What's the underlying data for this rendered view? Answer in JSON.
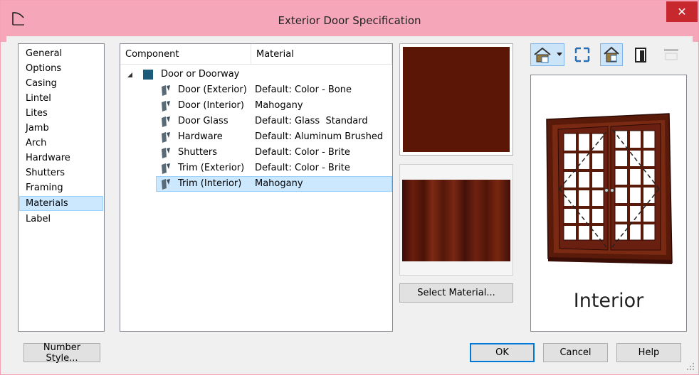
{
  "window": {
    "title": "Exterior Door Specification",
    "close_glyph": "✕",
    "accent": "#f6a6b9"
  },
  "nav": {
    "items": [
      {
        "label": "General",
        "selected": false
      },
      {
        "label": "Options",
        "selected": false
      },
      {
        "label": "Casing",
        "selected": false
      },
      {
        "label": "Lintel",
        "selected": false
      },
      {
        "label": "Lites",
        "selected": false
      },
      {
        "label": "Jamb",
        "selected": false
      },
      {
        "label": "Arch",
        "selected": false
      },
      {
        "label": "Hardware",
        "selected": false
      },
      {
        "label": "Shutters",
        "selected": false
      },
      {
        "label": "Framing",
        "selected": false
      },
      {
        "label": "Materials",
        "selected": true
      },
      {
        "label": "Label",
        "selected": false
      }
    ]
  },
  "components": {
    "header_component": "Component",
    "header_material": "Material",
    "root": {
      "label": "Door or Doorway",
      "expanded": true,
      "color": "#1c5b7a"
    },
    "rows": [
      {
        "component": "Door (Exterior)",
        "material": "Default: Color - Bone",
        "selected": false
      },
      {
        "component": "Door (Interior)",
        "material": "Mahogany",
        "selected": false
      },
      {
        "component": "Door Glass",
        "material": "Default: Glass  Standard",
        "selected": false
      },
      {
        "component": "Hardware",
        "material": "Default: Aluminum Brushed",
        "selected": false
      },
      {
        "component": "Shutters",
        "material": "Default: Color - Brite",
        "selected": false
      },
      {
        "component": "Trim (Exterior)",
        "material": "Default: Color - Brite",
        "selected": false
      },
      {
        "component": "Trim (Interior)",
        "material": "Mahogany",
        "selected": true
      }
    ]
  },
  "swatch": {
    "color": "#5b1605"
  },
  "buttons": {
    "select_material": "Select Material...",
    "number_style": "Number Style...",
    "ok": "OK",
    "cancel": "Cancel",
    "help": "Help"
  },
  "toolbar": {
    "icons": [
      "view-angle-icon",
      "dropdown-arrow-icon",
      "fill-window-icon",
      "interior-view-icon",
      "exterior-view-icon",
      "reset-view-icon"
    ]
  },
  "preview": {
    "label": "Interior"
  }
}
